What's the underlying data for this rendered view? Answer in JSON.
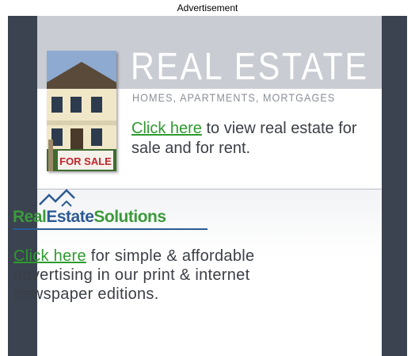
{
  "ad_label": "Advertisement",
  "real_estate": {
    "title": "REAL ESTATE",
    "subtitle": "HOMES, APARTMENTS, MORTGAGES",
    "link_text": "Click here",
    "body_text": " to view real estate for sale and for rent.",
    "photo_sign": "FOR SALE"
  },
  "logo": {
    "real": "Real",
    "estate": "Estate",
    "solutions": "Solutions",
    "icon": "roof-icon"
  },
  "solutions": {
    "link_text": "Click here",
    "body_text": " for simple & affordable advertising in our print & internet newspaper editions."
  },
  "colors": {
    "frame": "#3b4350",
    "band": "#c9ccd3",
    "link_green": "#2f9a2f",
    "logo_blue": "#2c5a93"
  }
}
